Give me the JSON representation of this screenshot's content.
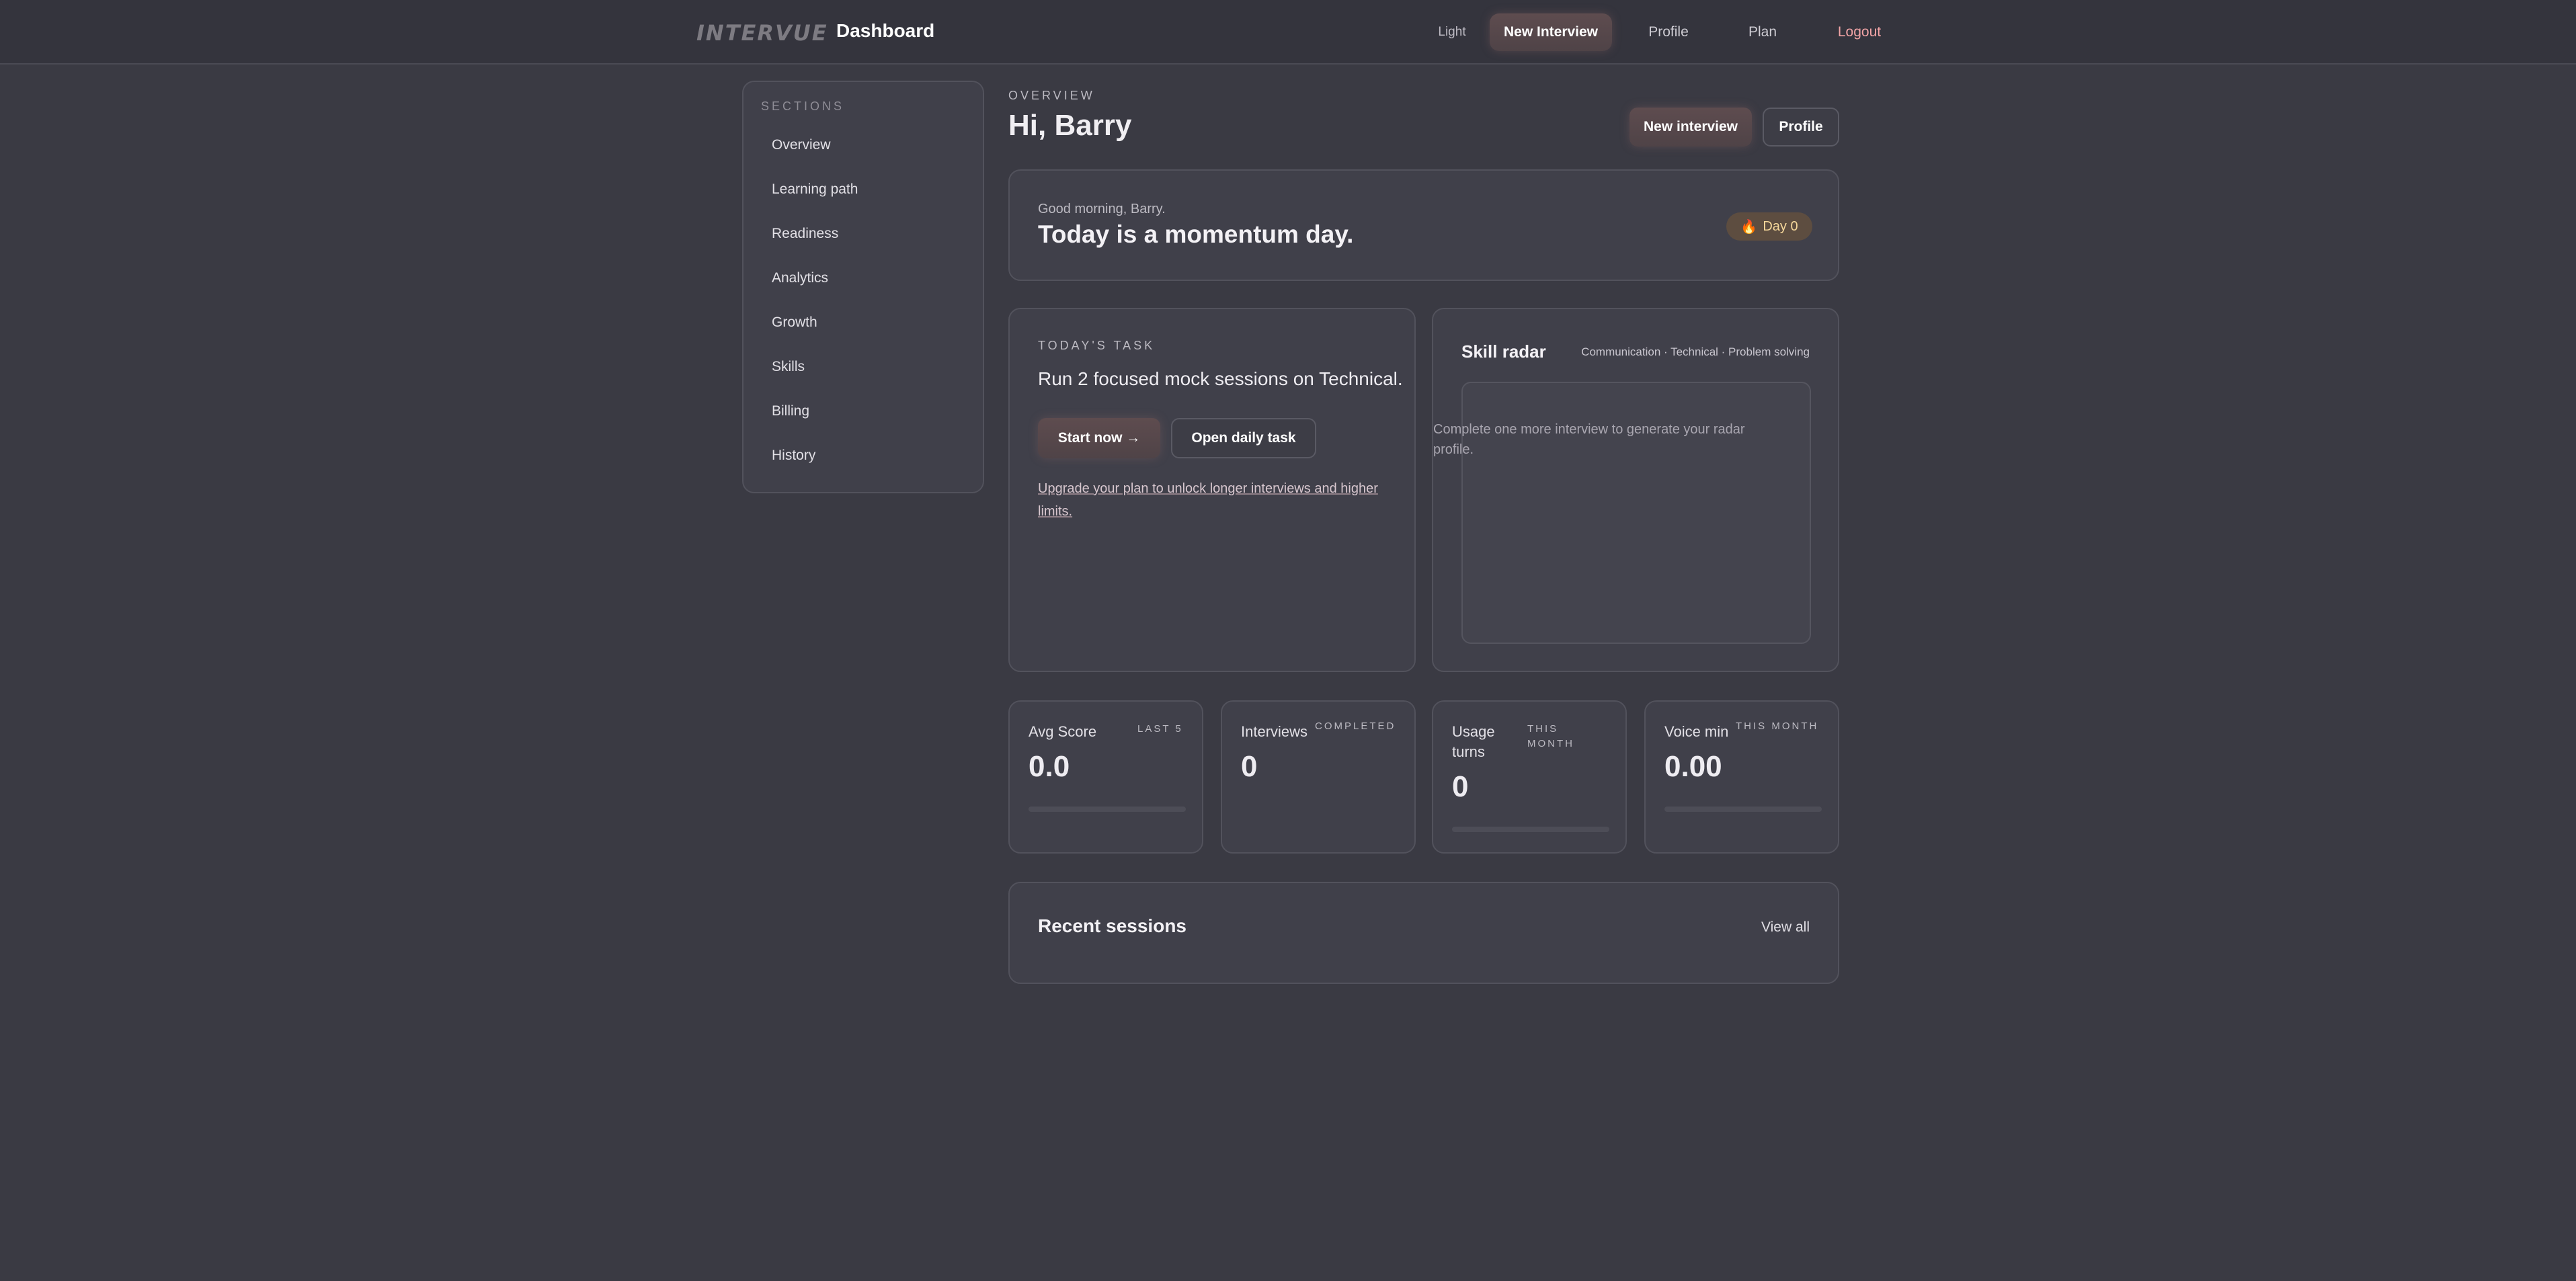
{
  "topbar": {
    "logo": "INTERVUE",
    "title": "Dashboard",
    "nav": {
      "light": "Light",
      "new_interview": "New Interview",
      "profile": "Profile",
      "plan": "Plan",
      "logout": "Logout"
    }
  },
  "sidebar": {
    "heading": "SECTIONS",
    "items": [
      {
        "label": "Overview"
      },
      {
        "label": "Learning path"
      },
      {
        "label": "Readiness"
      },
      {
        "label": "Analytics"
      },
      {
        "label": "Growth"
      },
      {
        "label": "Skills"
      },
      {
        "label": "Billing"
      },
      {
        "label": "History"
      }
    ]
  },
  "header": {
    "eyebrow": "OVERVIEW",
    "greeting": "Hi, Barry",
    "new_interview": "New interview",
    "profile": "Profile"
  },
  "momentum": {
    "small": "Good morning, Barry.",
    "headline": "Today is a momentum day.",
    "streak": "Day 0",
    "streak_icon": "flame-icon"
  },
  "task": {
    "label": "TODAY'S TASK",
    "text": "Run 2 focused mock sessions on Technical.",
    "start": "Start now →",
    "open": "Open daily task",
    "upgrade": "Upgrade your plan to unlock longer interviews and higher limits."
  },
  "radar": {
    "title": "Skill radar",
    "legend": "Communication · Technical · Problem solving",
    "empty": "Complete one more interview to generate your radar profile."
  },
  "metrics": [
    {
      "name": "Avg Score",
      "tag": "LAST 5",
      "value": "0.0",
      "progress": 0
    },
    {
      "name": "Interviews",
      "tag": "COMPLETED",
      "value": "0"
    },
    {
      "name": "Usage turns",
      "tag": "THIS MONTH",
      "value": "0",
      "progress": 0
    },
    {
      "name": "Voice min",
      "tag": "THIS MONTH",
      "value": "0.00",
      "progress": 0
    }
  ],
  "recent": {
    "title": "Recent sessions",
    "view_all": "View all"
  },
  "colors": {
    "background": "#3a3a43",
    "card": "#40404a",
    "accent_button": "#5e4c4f",
    "logout": "#f2a4a6",
    "streak": "#f5d79a"
  }
}
